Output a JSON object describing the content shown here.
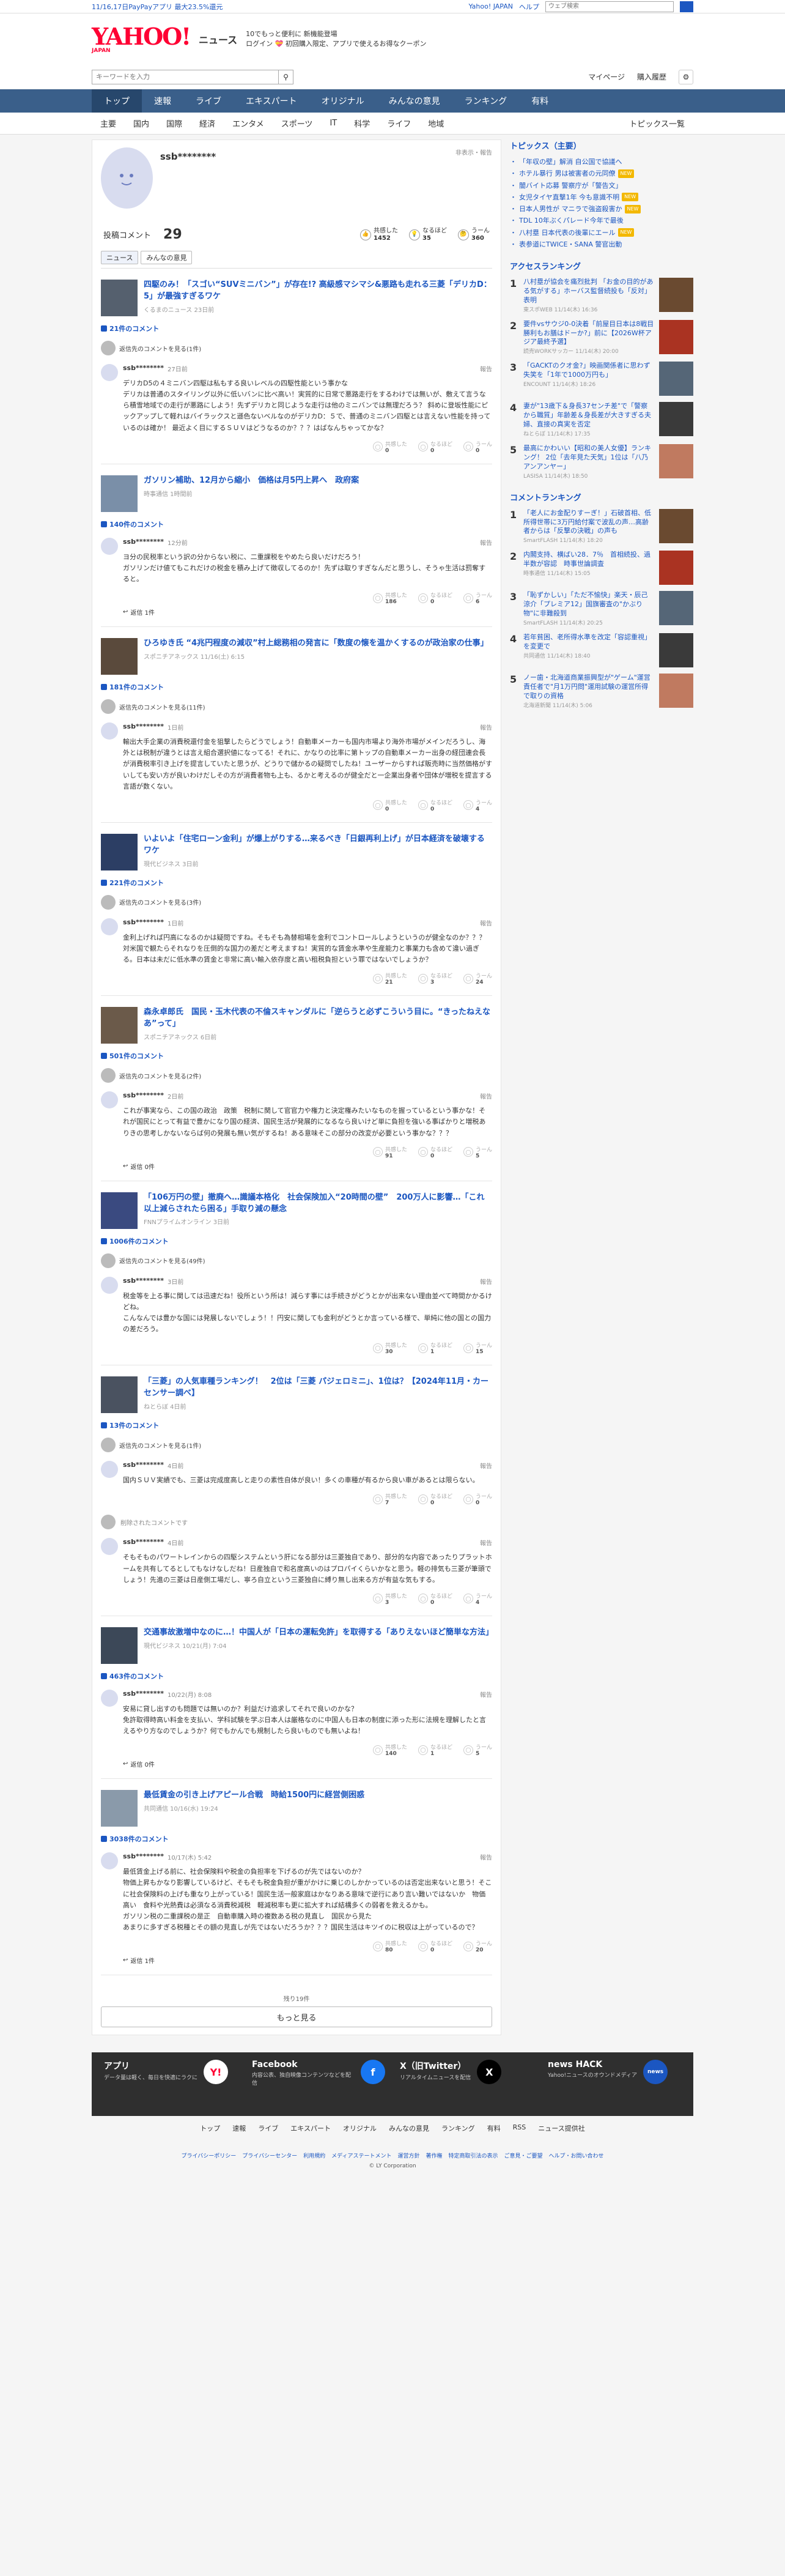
{
  "topbar": {
    "promo": "11/16,17日PayPayアプリ 最大23.5%還元",
    "links": [
      "Yahoo! JAPAN",
      "ヘルプ"
    ],
    "search_placeholder": "ウェブ検索"
  },
  "header": {
    "news": "ニュース",
    "ad1": "10でもっと便利に 新機能登場",
    "ad2": "ログイン 💝 初回購入限定、アプリで使えるお得なクーポン"
  },
  "search": {
    "placeholder": "キーワードを入力",
    "mypage": "マイページ",
    "purchase": "購入履歴"
  },
  "nav": [
    "トップ",
    "速報",
    "ライブ",
    "エキスパート",
    "オリジナル",
    "みんなの意見",
    "ランキング",
    "有料"
  ],
  "subnav": [
    "主要",
    "国内",
    "国際",
    "経済",
    "エンタメ",
    "スポーツ",
    "IT",
    "科学",
    "ライフ",
    "地域"
  ],
  "subnav_last": "トピックス一覧",
  "profile": {
    "name": "ssb********",
    "report": "非表示・報告",
    "label": "投稿コメント",
    "count": "29",
    "reactions": [
      {
        "icon": "👍",
        "label": "共感した",
        "value": "1452"
      },
      {
        "icon": "💡",
        "label": "なるほど",
        "value": "35"
      },
      {
        "icon": "🤔",
        "label": "うーん",
        "value": "360"
      }
    ]
  },
  "tabs": [
    "ニュース",
    "みんなの意見"
  ],
  "articles": [
    {
      "title": "四駆のみ！「スゴい“SUVミニバン”」が存在!? 高級感マシマシ&悪路も走れる三菱「デリカD：5」が最強すぎるワケ",
      "source": "くるまのニュース 23日前",
      "count": "21件のコメント",
      "reply_link": "返信先のコメントを見る(1件)",
      "comment": "デリカD5の４ミニバン四駆は私もする良いレベルの四駆性能という事かな\nデリカは普通のスタイリング以外に低いバンに比べ高い！実質的に日常で悪路走行をするわけでは無いが、敷えて言うなら積雪地域での走行が悪路にしよう！先ずデリカと同じような走行は他のミニバンでは無理だろう？ 斜めに登坂性能にピックアップして軽れはバイラックスと遜色ないベルなのがデリカD：５で、普通のミニバン四駆とは言えない性能を持っているのは確か！ 最近よく目にするＳＵＶはどうなるのか？？？はばなんちゃってかな？",
      "time": "27日前",
      "reactions": [
        "0",
        "0",
        "0"
      ],
      "replies": ""
    },
    {
      "title": "ガソリン補助、12月から縮小　価格は月5円上昇へ　政府案",
      "source": "時事通信 1時間前",
      "count": "140件のコメント",
      "reply_link": "",
      "comment": "ヨ分の民税率という訳の分からない税に、二重課税をやめたら良いだけだろう！\nガソリンだけ値てもこれだけの税金を積み上げて徴収してるのか！先ずは取りすぎなんだと思うし、そうゃ生活は罰奪すると。",
      "time": "12分前",
      "reactions": [
        "186",
        "0",
        "6"
      ],
      "replies": "返信 1件"
    },
    {
      "title": "ひろゆき氏 “4兆円程度の減収”村上総務相の発言に「数度の懐を温かくするのが政治家の仕事」",
      "source": "スポニチアネックス 11/16(土) 6:15",
      "count": "181件のコメント",
      "reply_link": "返信先のコメントを見る(11件)",
      "comment": "輸出大手企業の消費税還付金を狙撃したらどうでしょう！自動車メーカーも国内市場より海外市場がメインだろうし、海外とは税制が違うとは言え組合選択値になってる！それに、かなりの比率に第トップの自動車メーカー出身の経団連会長が消費税率引き上げを提言していたと思うが、どうりで儲かるの疑問でしたね！ユーザーからすれば販売時に当然価格がすいしても安い方が良いわけだしその方が消費者物も上も、るかと考えるのが健全だと一企業出身者や団体が増税を提言する言語が数くない。",
      "time": "1日前",
      "reactions": [
        "0",
        "0",
        "4"
      ],
      "replies": ""
    },
    {
      "title": "いよいよ「住宅ローン金利」が爆上がりする…来るべき「日銀再利上げ」が日本経済を破壊するワケ",
      "source": "現代ビジネス 3日前",
      "count": "221件のコメント",
      "reply_link": "返信先のコメントを見る(3件)",
      "comment": "金利上げれば円高になるのかは疑問ですね。そもそも為替相場を金利でコントロールしようというのが健全なのか？？？\n対米国で観たらそれなりを圧倒的な国力の差だと考えますね！実質的な賃金水準や生産能力と事業力も含めて違い過ぎる。日本は未だに低水準の賃金と非常に高い輸入依存度と高い租税負担という罪ではないでしょうか？",
      "time": "1日前",
      "reactions": [
        "21",
        "3",
        "24"
      ],
      "replies": ""
    },
    {
      "title": "森永卓郎氏　国民・玉木代表の不倫スキャンダルに「逆らうと必ずこういう目に。“きったねえなあ”って」",
      "source": "スポニチアネックス 6日前",
      "count": "501件のコメント",
      "reply_link": "返信先のコメントを見る(2件)",
      "comment": "これが事実なら、この国の政治　政策　税制に関して官官力や権力と決定権みたいなものを握っているという事かな！それが国民にとって有益で豊かになり国の経済、国民生活が発展的になるなら良いけど単に負担を強いる事ばかりと増税ありきの思考しかないならば何の発展も無い気がするね！ある意味そこの部分の改変が必要という事かな？？？",
      "time": "2日前",
      "reactions": [
        "91",
        "0",
        "5"
      ],
      "replies": "返信 0件"
    },
    {
      "title": "「106万円の壁」撤廃へ…識議本格化　社会保険加入“20時間の壁”　200万人に影響…「これ以上減らされたら困る」手取り減の懸念",
      "source": "FNNプライムオンライン 3日前",
      "count": "1006件のコメント",
      "reply_link": "返信先のコメントを見る(49件)",
      "comment": "税金等を上る事に関しては迅速だね！役所という所は！減らす事には手続きがどうとかが出来ない理由並べて時間かかるけどね。\nこんなんでは豊かな国には発展しないでしょう！！円安に関しても金利がどうとか言っている様で、単純に他の国との国力の差だろう。",
      "time": "3日前",
      "reactions": [
        "30",
        "1",
        "15"
      ],
      "replies": ""
    },
    {
      "title": "「三菱」の人気車種ランキング！　2位は「三菱 パジェロミニ」、1位は？【2024年11月・カーセンサー調べ】",
      "source": "ねとらぼ 4日前",
      "count": "13件のコメント",
      "reply_link": "返信先のコメントを見る(1件)",
      "comment": "国内ＳＵＶ実績でも、三菱は完成度高しと走りの素性自体が良い！多くの車種が有るから良い車があるとは限らない。",
      "time": "4日前",
      "reactions": [
        "7",
        "0",
        "0"
      ],
      "replies": "",
      "deleted": "削除されたコメントです",
      "comment2": "そもそものパワートレインからの四駆システムという肝になる部分は三菱独自であり、部分的な内容であったりプラットホームを共有してるとしてもなけなしだね！日産独自で和名度高いのはプロパイくらいかなと思う。軽の排気も三菱が筆頭でしょう！先進の三菱は日産側工場だし、寧ろ自立という三菱独自に縛り無し出来る方が有益な気もする。",
      "time2": "4日前",
      "reactions2": [
        "3",
        "0",
        "4"
      ]
    },
    {
      "title": "交通事故激増中なのに…！中国人が「日本の運転免許」を取得する「ありえないほど簡単な方法」",
      "source": "現代ビジネス 10/21(月) 7:04",
      "count": "463件のコメント",
      "reply_link": "",
      "comment": "安易に貸し出すのも問題では無いのか？利益だけ追求してそれで良いのかな？\n免許取得時高い料金を支払い、学科試験を学ぶ日本人は厳格なのに中国人も日本の制度に添った形に法規を理解したと言えるやり方なのでしょうか？何でもかんでも規制したら良いものでも無いよね！",
      "time": "10/22(月) 8:08",
      "reactions": [
        "140",
        "1",
        "5"
      ],
      "replies": "返信 0件"
    },
    {
      "title": "最低賃金の引き上げアピール合戦　時給1500円に経営側困惑",
      "source": "共同通信 10/16(水) 19:24",
      "count": "3038件のコメント",
      "reply_link": "",
      "comment": "最低賃金上げる前に、社会保険料や税金の負担率を下げるのが先ではないのか？\n物価上昇もかなり影響しているけど、そもそも税金負担が重がかけに乗じのしかかっているのは否定出来ないと思う！そこに社会保険料の上げも重なり上がっている！国民生活一般家庭はかなりある意味で逆行にあり言い難いではないか　物価高い　食料や光熱費は必須なる消費税減税　軽減税率も更に拡大すれば結構多くの弱者を救えるかも。\nガソリン税の二重課税の是正　自動車購入時の複数ある税の見直し　国民から見た\nあまりに多すぎる税種とその額の見直しが先ではないだろうか？？？国民生活はキツイのに税収は上がっているので？",
      "time": "10/17(木) 5:42",
      "reactions": [
        "80",
        "0",
        "20"
      ],
      "replies": "返信 1件"
    }
  ],
  "more": {
    "remaining": "残り19件",
    "button": "もっと見る"
  },
  "side": {
    "topics_title": "トピックス（主要）",
    "topics": [
      {
        "t": "「年収の壁」解消 自公国で協議へ",
        "b": ""
      },
      {
        "t": "ホテル暴行 男は被害者の元同僚",
        "b": "NEW"
      },
      {
        "t": "闇バイト応募 警察庁が「警告文」",
        "b": ""
      },
      {
        "t": "女児タイヤ直撃1年 今も意識不明",
        "b": "NEW"
      },
      {
        "t": "日本人男性が マニラで強盗殺害か",
        "b": "NEW"
      },
      {
        "t": "TDL 10年ぶくパレード今年で最後",
        "b": ""
      },
      {
        "t": "八村塁 日本代表の後輩にエール",
        "b": "NEW"
      },
      {
        "t": "表参道にTWICE・SANA 警官出動",
        "b": ""
      }
    ],
    "access_title": "アクセスランキング",
    "access": [
      {
        "t": "八村塁が協会を痛烈批判 「お金の目的がある気がする」ホーバス監督続投も「反対」表明",
        "m": "東スポWEB 11/14(木) 16:36"
      },
      {
        "t": "要件vsサウジ0-0決着「前屋目日本は8戦目勝利もお膳はドーか?」前に【2026W杯アジア最終予選】",
        "m": "読売WORKサッカー 11/14(木) 20:00"
      },
      {
        "t": "「GACKTのクオ金?」映画関係者に思わず失笑を「1年で1000万円も」",
        "m": "ENCOUNT 11/14(木) 18:26"
      },
      {
        "t": "妻が\"13歳下＆身長37センチ差\"で「警察から職質」年齢差＆身長差が大きすぎる夫婦、直接の真実を否定",
        "m": "ねとらぼ 11/14(木) 17:35"
      },
      {
        "t": "最高にかわいい【昭和の美人女優】ランキング！ 2位「去年見た天気」1位は「八乃アンアンヤー」",
        "m": "LASISA 11/14(木) 18:50"
      }
    ],
    "comment_title": "コメントランキング",
    "crank": [
      {
        "t": "「老人にお金配りすーぎ！」石破首相、低所得世帯に3万円給付案で波乱の声…高齢者からは「反撃の決戦」の声も",
        "m": "SmartFLASH 11/14(木) 18:20"
      },
      {
        "t": "内閣支持、横ばい28．7％　首相続投、過半数が容認　時事世論調査",
        "m": "時事通信 11/14(木) 15:05"
      },
      {
        "t": "「恥ずかしい」「ただ不愉快」楽天・辰己涼介「プレミア12」国旗審査の\"かぶり物\"に非難殺到",
        "m": "SmartFLASH 11/14(木) 20:25"
      },
      {
        "t": "若年貧困、老所得水準を改定「容認重視」を変更で",
        "m": "共同通信 11/14(木) 18:40"
      },
      {
        "t": "ノー歯・北海道商業振興型が\"ゲーム\"運営責任者で\"月1万円問\"運用試験の運営所得で取りの資格",
        "m": "北海道新聞 11/14(木) 5:06"
      }
    ]
  },
  "footer": {
    "cols": [
      {
        "h": "アプリ",
        "s": "データ量は軽く、毎日を快適にラクに",
        "i": "Y!"
      },
      {
        "h": "Facebook",
        "s": "内容公表、独自映像コンテンツなどを配信",
        "i": "f"
      },
      {
        "h": "X（旧Twitter）",
        "s": "リアルタイムニュースを配信",
        "i": "X"
      },
      {
        "h": "news HACK",
        "s": "Yahoo!ニュースのオウンドメディア",
        "i": "news"
      }
    ],
    "links": [
      "トップ",
      "速報",
      "ライブ",
      "エキスパート",
      "オリジナル",
      "みんなの意見",
      "ランキング",
      "有料",
      "RSS",
      "ニュース提供社"
    ],
    "legal": [
      "プライバシーポリシー",
      "プライバシーセンター",
      "利用規約",
      "メディアステートメント",
      "運営方針",
      "著作権",
      "特定商取引法の表示",
      "ご意見・ご要望",
      "ヘルプ・お問い合わせ"
    ],
    "copyright": "© LY Corporation"
  },
  "colors": {
    "accent": "#1b56c1",
    "nav": "#3a5f8a",
    "brand": "#ff0033"
  }
}
